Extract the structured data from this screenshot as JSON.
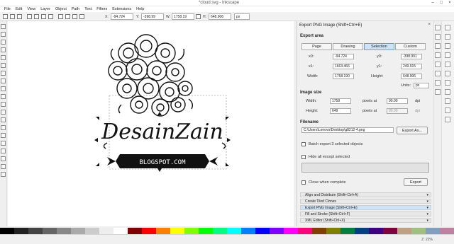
{
  "window": {
    "title": "*cloud.svg - Inkscape"
  },
  "menu": [
    "File",
    "Edit",
    "View",
    "Layer",
    "Object",
    "Path",
    "Text",
    "Filters",
    "Extensions",
    "Help"
  ],
  "controls": {
    "x_label": "X:",
    "x_value": "-94.724",
    "y_label": "Y:",
    "y_value": "-398.99",
    "w_label": "W:",
    "w_value": "1758.19",
    "h_label": "H:",
    "h_value": "648.906",
    "unit": "px"
  },
  "artwork": {
    "title": "DesainZain",
    "subtitle": "BLOGSPOT.COM"
  },
  "export_dialog": {
    "title": "Export PNG Image (Shift+Ctrl+E)",
    "export_area_label": "Export area",
    "area_tabs": [
      "Page",
      "Drawing",
      "Selection",
      "Custom"
    ],
    "selected_tab": "Selection",
    "x0_label": "x0:",
    "x0_value": "-94.724",
    "y0_label": "y0:",
    "y0_value": "-398.991",
    "x1_label": "x1:",
    "x1_value": "1663.466",
    "y1_label": "y1:",
    "y1_value": "249.915",
    "width_label": "Width:",
    "width_value": "1758.190",
    "height_label": "Height:",
    "height_value": "648.906",
    "units_label": "Units:",
    "units_value": "px",
    "image_size_label": "Image size",
    "img_width_label": "Width:",
    "img_width_value": "1758",
    "img_height_label": "Height:",
    "img_height_value": "649",
    "pixels_at_label": "pixels at",
    "dpi_value": "90.00",
    "dpi_value_2": "90.00",
    "dpi_label": "dpi",
    "filename_label": "Filename",
    "filename_value": "C:\\Users\\Lenovo\\Desktop\\g8212-4.png",
    "export_as_label": "Export As...",
    "batch_label": "Batch export 3 selected objects",
    "hide_label": "Hide all except selected",
    "close_label": "Close when complete",
    "export_label": "Export"
  },
  "dock_panels": [
    {
      "label": "Align and Distribute (Shift+Ctrl+A)",
      "active": false
    },
    {
      "label": "Create Tiled Clones",
      "active": false
    },
    {
      "label": "Export PNG Image (Shift+Ctrl+E)",
      "active": true
    },
    {
      "label": "Fill and Stroke (Shift+Ctrl+F)",
      "active": false
    },
    {
      "label": "XML Editor (Shift+Ctrl+X)",
      "active": false
    }
  ],
  "status": {
    "zoom": "Z: 22%"
  },
  "colors": {
    "selected_tab": "#cfe3f7",
    "accent": "#6a9fd4"
  }
}
